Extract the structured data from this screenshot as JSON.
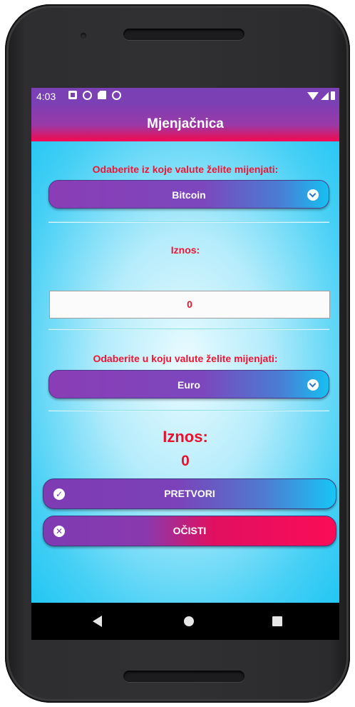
{
  "status_bar": {
    "time": "4:03"
  },
  "app": {
    "title": "Mjenjačnica"
  },
  "from_section": {
    "label": "Odaberite iz koje valute želite mijenjati:",
    "selected": "Bitcoin"
  },
  "amount_section": {
    "label": "Iznos:",
    "value": "0"
  },
  "to_section": {
    "label": "Odaberite u koju valute želite mijenjati:",
    "selected": "Euro"
  },
  "result": {
    "label": "Iznos:",
    "value": "0"
  },
  "buttons": {
    "convert_label": "PRETVORI",
    "clear_label": "OČISTI"
  },
  "icons": {
    "convert": "check-icon",
    "clear": "close-icon",
    "spinner": "chevron-down-icon"
  },
  "colors": {
    "accent_purple": "#7e3bb3",
    "accent_pink": "#f70a55",
    "accent_cyan": "#17c6f5",
    "text_red": "#e8122c"
  }
}
